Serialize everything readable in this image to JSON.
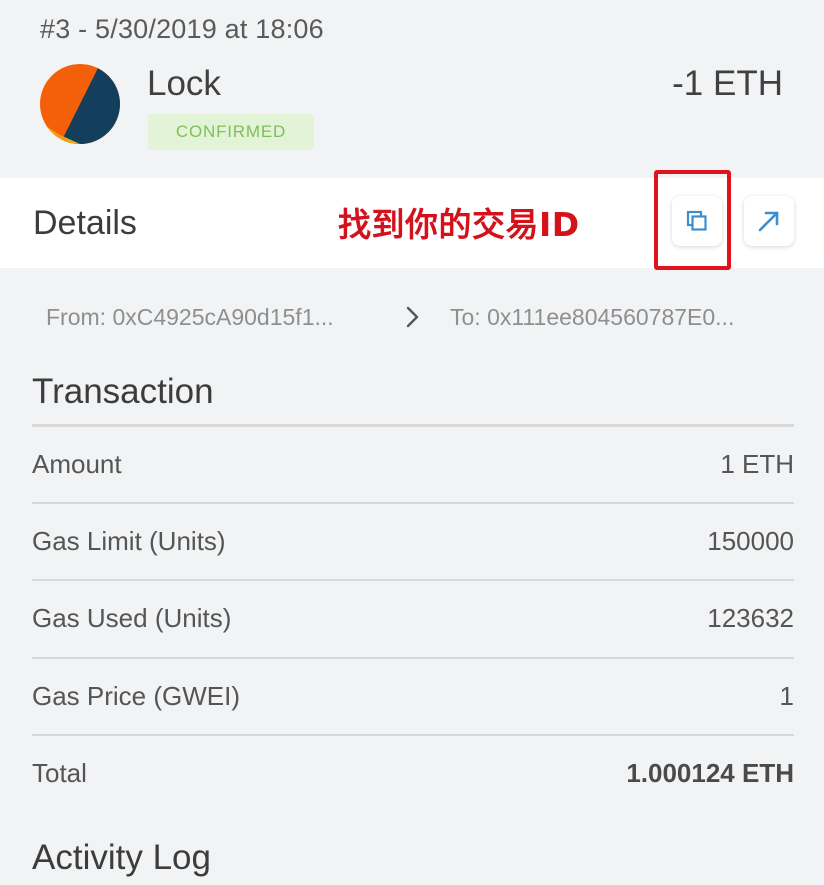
{
  "header": {
    "meta": "#3 - 5/30/2019 at 18:06",
    "action": "Lock",
    "status": "CONFIRMED",
    "value": "-1 ETH"
  },
  "details": {
    "title": "Details",
    "annotation": "找到你的交易ID",
    "copy_icon": "copy-icon",
    "open_icon": "external-link-icon",
    "highlight_color": "#e0131d"
  },
  "addresses": {
    "from": "From: 0xC4925cA90d15f1...",
    "to": "To: 0x111ee804560787E0..."
  },
  "transaction": {
    "title": "Transaction",
    "rows": [
      {
        "label": "Amount",
        "value": "1 ETH"
      },
      {
        "label": "Gas Limit (Units)",
        "value": "150000"
      },
      {
        "label": "Gas Used (Units)",
        "value": "123632"
      },
      {
        "label": "Gas Price (GWEI)",
        "value": "1"
      },
      {
        "label": "Total",
        "value": "1.000124 ETH"
      }
    ]
  },
  "activity": {
    "title": "Activity Log"
  },
  "colors": {
    "accent": "#3b8fd1",
    "status_bg": "#e3f3d8",
    "status_text": "#7fbf5a",
    "annotation": "#d4121c"
  }
}
